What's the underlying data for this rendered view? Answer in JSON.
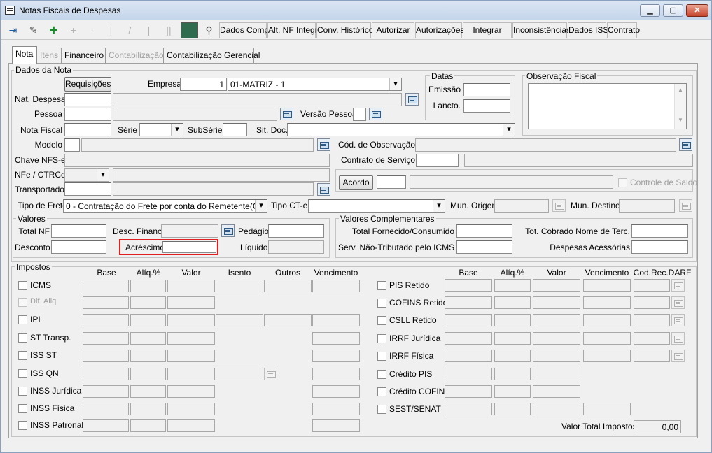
{
  "window": {
    "title": "Notas Fiscais de Despesas",
    "min": "▁",
    "max": "▢",
    "close": "✕"
  },
  "toolbar": {
    "dados_comp": "Dados Comp.",
    "alt_nf": "Alt. NF Integr.",
    "conv_historico": "Conv. Histórico",
    "autorizar": "Autorizar",
    "autorizacoes": "Autorizações",
    "integrar": "Integrar",
    "inconsistencias": "Inconsistências",
    "dados_iss": "Dados ISS",
    "contrato": "Contrato",
    "icons": {
      "exit": "⇥",
      "edit": "✎",
      "new": "✚",
      "binoculars": "⚲"
    }
  },
  "tabs": {
    "nota": "Nota",
    "itens": "Itens",
    "financeiro": "Financeiro",
    "contabilizacao": "Contabilização",
    "contab_gerencial": "Contabilização Gerencial"
  },
  "dados_nota": {
    "group": "Dados da Nota",
    "requisicoes": "Requisições",
    "empresa_label": "Empresa",
    "empresa_code": "1",
    "empresa_name": "01-MATRIZ - 1",
    "nat_despesa": "Nat. Despesa",
    "pessoa": "Pessoa",
    "versao_pessoa": "Versão Pessoa",
    "nota_fiscal": "Nota Fiscal",
    "serie": "Série",
    "subserie": "SubSérie",
    "sit_doc": "Sit. Doc.",
    "modelo": "Modelo",
    "cod_obs": "Cód. de Observação",
    "chave_nfse": "Chave NFS-e",
    "contrato_servico": "Contrato de Serviço",
    "nfe_ctrce": "NFe / CTRCe",
    "transportador": "Transportador",
    "acordo": "Acordo",
    "controle_saldo": "Controle de Saldo",
    "tipo_frete": "Tipo de Frete",
    "tipo_frete_value": "0 - Contratação do Frete por conta do Remetente(CIF)",
    "tipo_cte": "Tipo CT-e",
    "mun_origem": "Mun. Origem",
    "mun_destino": "Mun. Destino"
  },
  "datas": {
    "group": "Datas",
    "emissao": "Emissão",
    "lancto": "Lancto."
  },
  "obs_fiscal": {
    "group": "Observação Fiscal"
  },
  "valores": {
    "group": "Valores",
    "total_nf": "Total NF",
    "desc_financ": "Desc. Financ.",
    "pedagio": "Pedágio",
    "desconto": "Desconto",
    "acrescimo": "Acréscimo",
    "liquido": "Líquido"
  },
  "valores_comp": {
    "group": "Valores Complementares",
    "total_fornecido": "Total Fornecido/Consumido",
    "tot_cobrado": "Tot. Cobrado Nome de Terc.",
    "serv_nao_trib": "Serv. Não-Tributado pelo ICMS",
    "despesas_acess": "Despesas Acessórias"
  },
  "impostos": {
    "group": "Impostos",
    "left_headers": {
      "base": "Base",
      "aliq": "Alíq.%",
      "valor": "Valor",
      "isento": "Isento",
      "outros": "Outros",
      "vencimento": "Vencimento"
    },
    "right_headers": {
      "base": "Base",
      "aliq": "Alíq.%",
      "valor": "Valor",
      "vencimento": "Vencimento",
      "cod_rec": "Cod.Rec.DARF"
    },
    "left_rows": [
      "ICMS",
      "Dif. Aliq",
      "IPI",
      "ST Transp.",
      "ISS ST",
      "ISS QN",
      "INSS Jurídica",
      "INSS Física",
      "INSS Patronal"
    ],
    "right_rows": [
      "PIS Retido",
      "COFINS Retido",
      "CSLL Retido",
      "IRRF Jurídica",
      "IRRF Física",
      "Crédito PIS",
      "Crédito COFINS",
      "SEST/SENAT"
    ],
    "valor_total_label": "Valor Total Impostos",
    "valor_total": "0,00"
  }
}
